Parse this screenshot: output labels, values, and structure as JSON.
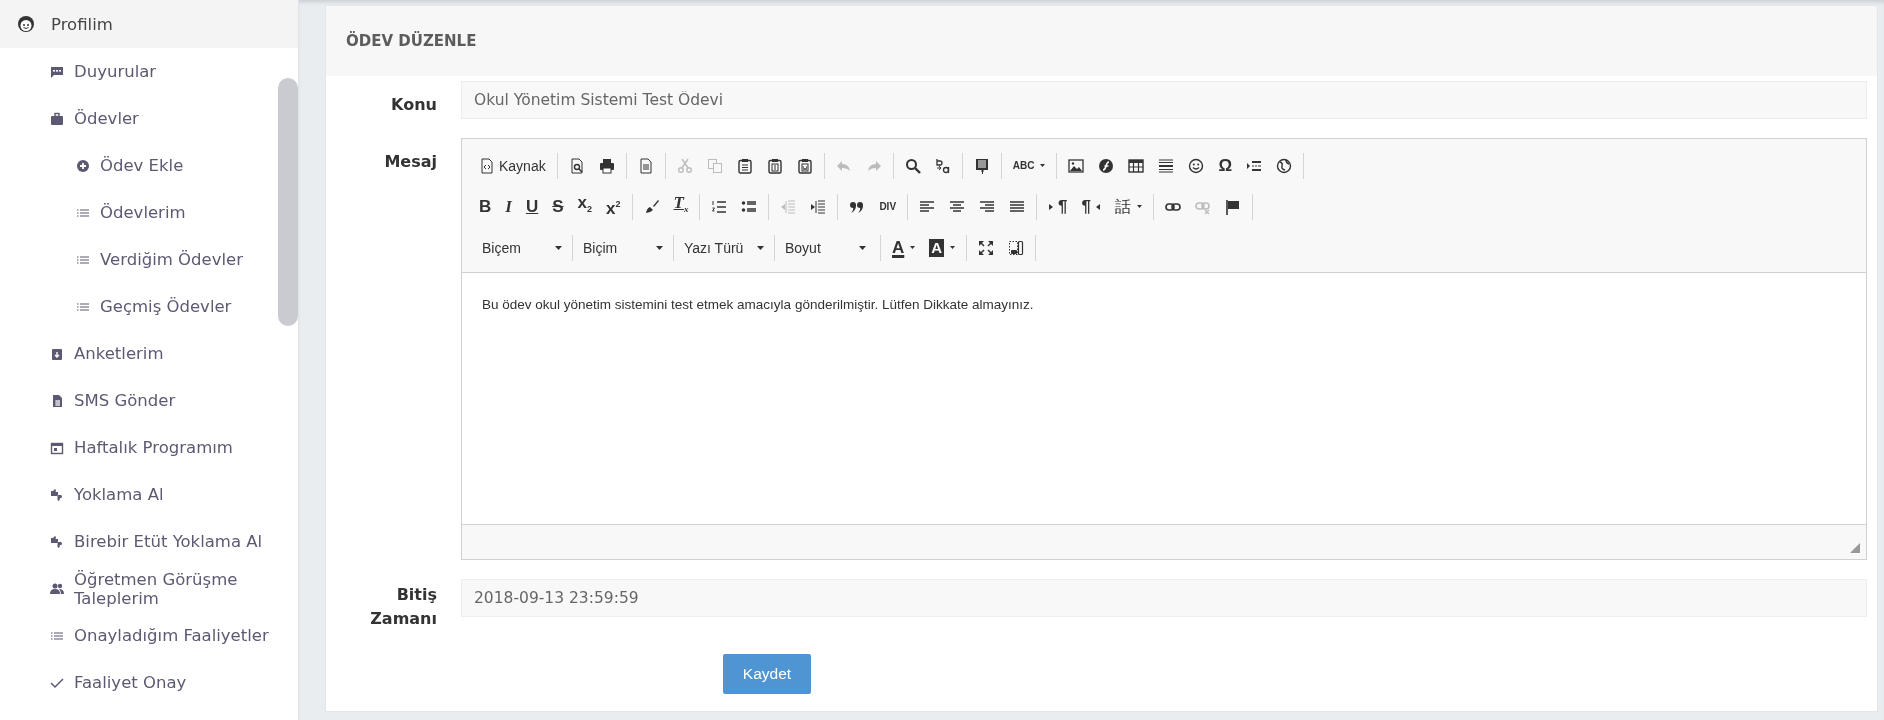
{
  "sidebar": {
    "items": [
      {
        "label": "Profilim",
        "children": [
          {
            "label": "Duyurular"
          },
          {
            "label": "Ödevler",
            "children": [
              {
                "label": "Ödev Ekle"
              },
              {
                "label": "Ödevlerim"
              },
              {
                "label": "Verdiğim Ödevler"
              },
              {
                "label": "Geçmiş Ödevler"
              }
            ]
          },
          {
            "label": "Anketlerim"
          },
          {
            "label": "SMS Gönder"
          },
          {
            "label": "Haftalık Programım"
          },
          {
            "label": "Yoklama Al"
          },
          {
            "label": "Birebir Etüt Yoklama Al"
          },
          {
            "label": "Öğretmen Görüşme Taleplerim"
          },
          {
            "label": "Onayladığım Faaliyetler"
          },
          {
            "label": "Faaliyet Onay"
          }
        ]
      }
    ]
  },
  "panel": {
    "title": "ÖDEV DÜZENLE",
    "subject": {
      "label": "Konu",
      "value": "Okul Yönetim Sistemi Test Ödevi"
    },
    "message": {
      "label": "Mesaj",
      "toolbar": [
        [
          [
            {
              "kind": "icon",
              "label": "Kaynak",
              "disabled": false
            }
          ],
          [
            {
              "kind": "icon",
              "disabled": false
            },
            {
              "kind": "icon",
              "disabled": false
            }
          ],
          [
            {
              "kind": "icon",
              "disabled": false
            }
          ],
          [
            {
              "kind": "icon",
              "disabled": true
            },
            {
              "kind": "icon",
              "disabled": true
            },
            {
              "kind": "icon",
              "disabled": false
            },
            {
              "kind": "icon",
              "disabled": false
            },
            {
              "kind": "icon",
              "disabled": false
            }
          ],
          [
            {
              "kind": "icon",
              "disabled": true
            },
            {
              "kind": "icon",
              "disabled": true
            }
          ],
          [
            {
              "kind": "icon",
              "disabled": false
            },
            {
              "kind": "icon",
              "disabled": false
            }
          ],
          [
            {
              "kind": "icon",
              "disabled": false
            }
          ],
          [
            {
              "kind": "tiny",
              "glyph": "ABC",
              "arrow": true,
              "disabled": false
            }
          ],
          [
            {
              "kind": "icon",
              "disabled": false
            },
            {
              "kind": "icon",
              "disabled": false
            },
            {
              "kind": "icon",
              "disabled": false
            },
            {
              "kind": "icon",
              "disabled": false
            },
            {
              "kind": "icon",
              "disabled": false
            },
            {
              "kind": "bold",
              "glyph": "Ω",
              "disabled": false
            },
            {
              "kind": "icon",
              "disabled": false
            },
            {
              "kind": "icon",
              "disabled": false
            }
          ]
        ],
        [
          [
            {
              "kind": "bold",
              "glyph": "B",
              "disabled": false
            },
            {
              "kind": "italic",
              "glyph": "I",
              "disabled": false
            },
            {
              "kind": "underline",
              "glyph": "U",
              "disabled": false
            },
            {
              "kind": "strike",
              "glyph": "S",
              "disabled": false
            },
            {
              "kind": "bold",
              "glyph": "x$_{2}$",
              "disabled": false
            },
            {
              "kind": "bold",
              "glyph": "x$^{2}$",
              "disabled": false
            }
          ],
          [
            {
              "kind": "icon",
              "disabled": false
            },
            {
              "kind": "clearformat",
              "glyph": "T$_{x}$",
              "disabled": false
            }
          ],
          [
            {
              "kind": "icon",
              "disabled": false
            },
            {
              "kind": "icon",
              "disabled": false
            }
          ],
          [
            {
              "kind": "icon",
              "disabled": true
            },
            {
              "kind": "icon",
              "disabled": false
            }
          ],
          [
            {
              "kind": "icon",
              "disabled": false
            },
            {
              "kind": "tiny",
              "glyph": "DIV",
              "disabled": false
            }
          ],
          [
            {
              "kind": "icon",
              "disabled": false
            },
            {
              "kind": "icon",
              "disabled": false
            },
            {
              "kind": "icon",
              "disabled": false
            },
            {
              "kind": "icon",
              "disabled": false
            }
          ],
          [
            {
              "kind": "ltr",
              "glyph": "¶",
              "disabled": false
            },
            {
              "kind": "rtl",
              "glyph": "¶",
              "disabled": false
            },
            {
              "kind": "plain",
              "glyph": "話",
              "arrow": true,
              "disabled": false
            }
          ],
          [
            {
              "kind": "icon",
              "disabled": false
            },
            {
              "kind": "icon",
              "disabled": true
            },
            {
              "kind": "icon",
              "disabled": false
            }
          ]
        ],
        [
          [
            {
              "kind": "combo",
              "label": "Biçem"
            },
            {
              "kind": "combo",
              "label": "Biçim"
            },
            {
              "kind": "combo",
              "label": "Yazı Türü"
            },
            {
              "kind": "combo",
              "label": "Boyut"
            }
          ],
          [
            {
              "kind": "colorbar",
              "glyph": "A",
              "arrow": true,
              "disabled": false
            },
            {
              "kind": "inverse",
              "glyph": "A",
              "arrow": true,
              "disabled": false
            }
          ],
          [
            {
              "kind": "icon",
              "disabled": false
            },
            {
              "kind": "icon",
              "disabled": false
            }
          ]
        ]
      ],
      "content": "Bu ödev okul yönetim sistemini test etmek amacıyla gönderilmiştir. Lütfen Dikkate almayınız."
    },
    "deadline": {
      "label": "Bitiş Zamanı",
      "value": "2018-09-13 23:59:59"
    },
    "submit": "Kaydet"
  }
}
